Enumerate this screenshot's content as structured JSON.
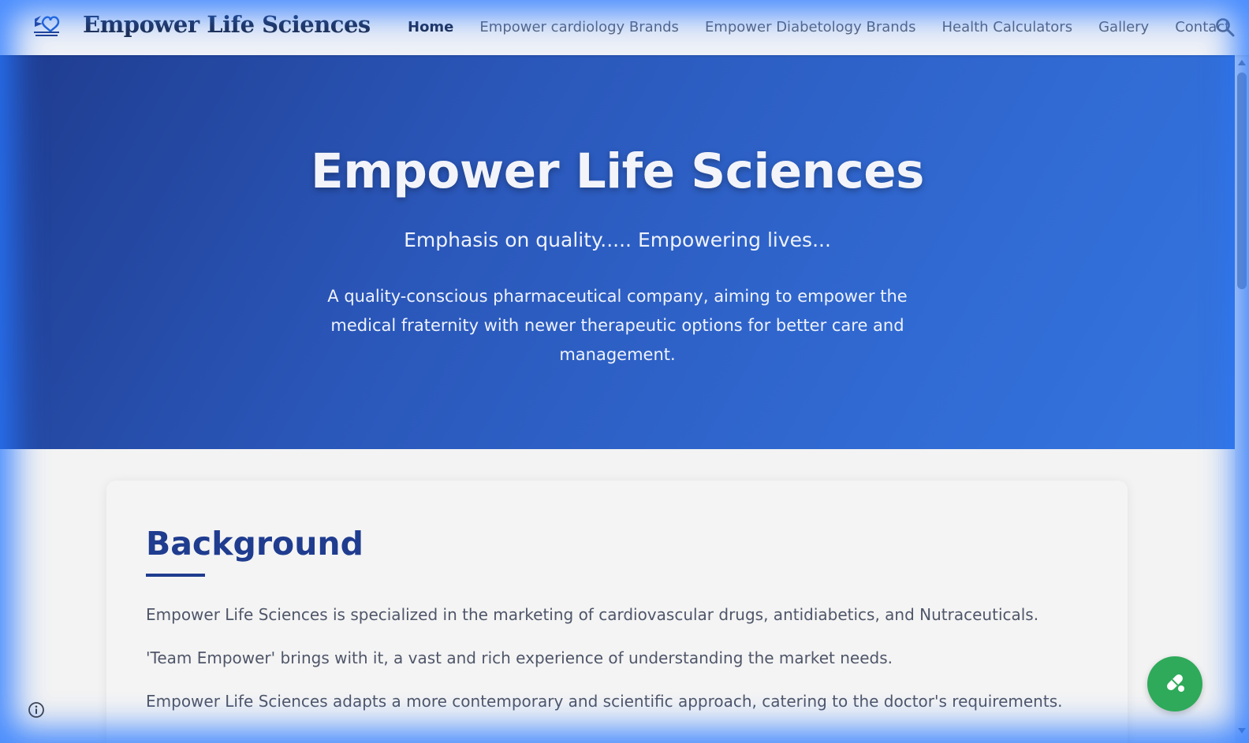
{
  "header": {
    "site_title": "Empower Life Sciences",
    "logo_icon": "empower-logo-icon",
    "nav": [
      {
        "label": "Home",
        "active": true
      },
      {
        "label": "Empower cardiology Brands",
        "active": false
      },
      {
        "label": "Empower Diabetology Brands",
        "active": false
      },
      {
        "label": "Health Calculators",
        "active": false
      },
      {
        "label": "Gallery",
        "active": false
      },
      {
        "label": "Contact",
        "active": false
      }
    ],
    "search_icon": "search-icon"
  },
  "hero": {
    "title": "Empower Life Sciences",
    "tagline": "Emphasis on quality..... Empowering lives...",
    "description": "A quality-conscious pharmaceutical company, aiming to empower the medical fraternity with newer therapeutic options for better care and management."
  },
  "background_section": {
    "title": "Background",
    "paragraphs": [
      "Empower Life Sciences is specialized in the marketing of cardiovascular drugs, antidiabetics, and Nutraceuticals.",
      "'Team Empower' brings with it, a vast and rich experience of understanding the market needs.",
      "Empower Life Sciences adapts a more contemporary and scientific approach, catering to the doctor's requirements."
    ]
  },
  "floating": {
    "info_icon": "info-icon",
    "fab_icon": "pill-icon"
  },
  "colors": {
    "brand_blue": "#1f3c8f",
    "hero_gradient_end": "#3575e0",
    "fab_green": "#2eaa5a"
  }
}
